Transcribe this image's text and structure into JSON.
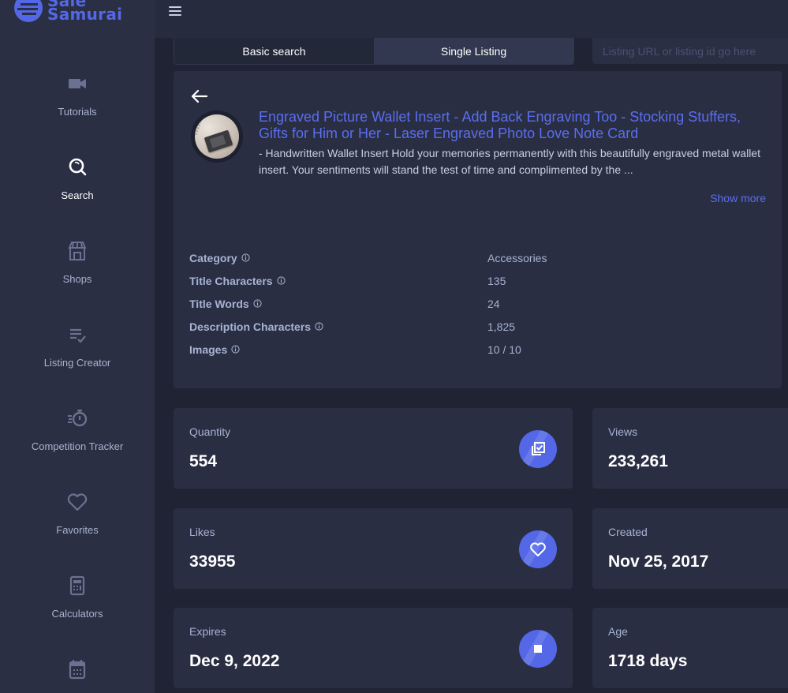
{
  "app": {
    "brand_line1": "Sale",
    "brand_line2": "Samurai",
    "brand_color": "#5468e7"
  },
  "sidebar": {
    "items": [
      {
        "label": "Tutorials",
        "icon": "video-camera-icon",
        "active": false
      },
      {
        "label": "Search",
        "icon": "search-icon",
        "active": true
      },
      {
        "label": "Shops",
        "icon": "storefront-icon",
        "active": false
      },
      {
        "label": "Listing Creator",
        "icon": "list-check-icon",
        "active": false
      },
      {
        "label": "Competition Tracker",
        "icon": "stopwatch-icon",
        "active": false
      },
      {
        "label": "Favorites",
        "icon": "heart-icon",
        "active": false
      },
      {
        "label": "Calculators",
        "icon": "calculator-icon",
        "active": false
      },
      {
        "label": "",
        "icon": "calendar-icon",
        "active": false
      }
    ]
  },
  "search": {
    "tabs": [
      {
        "label": "Basic search",
        "active": false
      },
      {
        "label": "Single Listing",
        "active": true
      }
    ],
    "input_value": "",
    "input_placeholder": "Listing URL or listing id go here"
  },
  "listing": {
    "title": "Engraved Picture Wallet Insert - Add Back Engraving Too - Stocking Stuffers, Gifts for Him or Her - Laser Engraved Photo Love Note Card",
    "description": "- Handwritten Wallet Insert Hold your memories permanently with this beautifully engraved metal wallet insert. Your sentiments will stand the test of time and complimented by the ...",
    "show_more": "Show more",
    "attributes": [
      {
        "key": "Category",
        "value": "Accessories"
      },
      {
        "key": "Title Characters",
        "value": "135"
      },
      {
        "key": "Title Words",
        "value": "24"
      },
      {
        "key": "Description Characters",
        "value": "1,825"
      },
      {
        "key": "Images",
        "value": "10 / 10"
      }
    ]
  },
  "stats": {
    "quantity": {
      "label": "Quantity",
      "value": "554",
      "icon": "copy-check-icon"
    },
    "views": {
      "label": "Views",
      "value": "233,261"
    },
    "likes": {
      "label": "Likes",
      "value": "33955",
      "icon": "heart-icon"
    },
    "created": {
      "label": "Created",
      "value": "Nov 25, 2017"
    },
    "expires": {
      "label": "Expires",
      "value": "Dec 9, 2022",
      "icon": "stop-icon"
    },
    "age": {
      "label": "Age",
      "value": "1718 days"
    }
  }
}
